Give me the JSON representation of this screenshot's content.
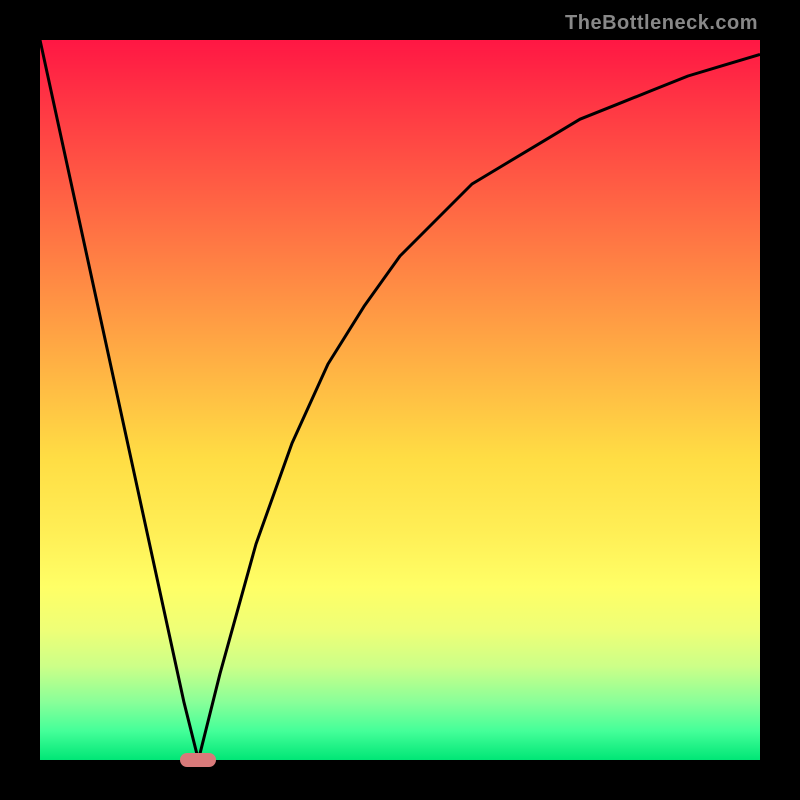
{
  "watermark": "TheBottleneck.com",
  "chart_data": {
    "type": "line",
    "title": "",
    "xlabel": "",
    "ylabel": "",
    "xlim": [
      0,
      100
    ],
    "ylim": [
      0,
      100
    ],
    "gradient_colors": {
      "top": "#ff1744",
      "middle": "#ffdd44",
      "bottom": "#00e676"
    },
    "series": [
      {
        "name": "bottleneck-curve",
        "x": [
          0,
          5,
          10,
          15,
          20,
          22,
          25,
          30,
          35,
          40,
          45,
          50,
          55,
          60,
          65,
          70,
          75,
          80,
          85,
          90,
          95,
          100
        ],
        "y": [
          100,
          77,
          54,
          31,
          8,
          0,
          12,
          30,
          44,
          55,
          63,
          70,
          75,
          80,
          83,
          86,
          89,
          91,
          93,
          95,
          96.5,
          98
        ]
      }
    ],
    "marker": {
      "x": 22,
      "y": 0,
      "color": "#d87a7a"
    }
  }
}
